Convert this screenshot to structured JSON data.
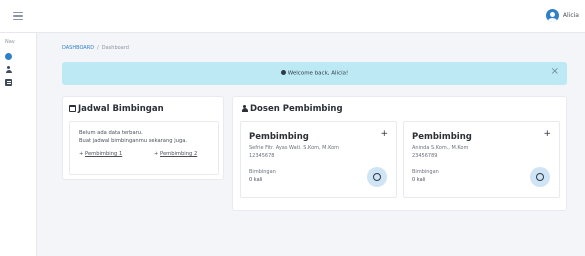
{
  "header": {
    "user_name": "Alicia"
  },
  "sidebar": {
    "title": "Nav"
  },
  "breadcrumb": {
    "root": "DASHBOARD",
    "separator": "/",
    "current": "Dashboard"
  },
  "alert": {
    "message": "Welcome back, Alicia!",
    "close": "×"
  },
  "jadwal": {
    "title": "Jadwal Bimbingan",
    "empty_line1": "Belum ada data terbaru.",
    "empty_line2": "Buat jadwal bimbinganmu sekarang juga.",
    "link1": "Pembimbing 1",
    "link2": "Pembimbing 2",
    "link_prefix": "+"
  },
  "dosen": {
    "title": "Dosen Pembimbing",
    "cards": [
      {
        "title": "Pembimbing",
        "add": "+",
        "name": "Sefrie Fitr. Ayas Wati. S.Kom, M.Kom",
        "nip": "12345678",
        "label": "Bimbingan",
        "count": "0 kali"
      },
      {
        "title": "Pembimbing",
        "add": "+",
        "name": "Aninda S.Kom., M.Kom",
        "nip": "23456789",
        "label": "Bimbingan",
        "count": "0 kali"
      }
    ]
  }
}
